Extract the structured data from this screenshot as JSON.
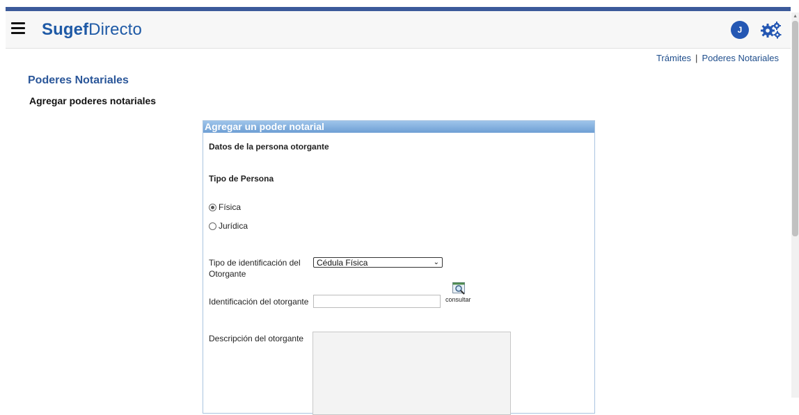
{
  "header": {
    "brand_bold": "Sugef",
    "brand_rest": "Directo",
    "avatar_initial": "J",
    "icons": [
      "hamburger-menu-icon",
      "settings-gears-icon"
    ],
    "accent_color": "#3c5a9a",
    "brand_color": "#1f5aa6"
  },
  "breadcrumb": {
    "items": [
      "Trámites",
      "Poderes Notariales"
    ],
    "separator": "|"
  },
  "page": {
    "title": "Poderes Notariales",
    "subtitle": "Agregar poderes notariales"
  },
  "form": {
    "panel_title": "Agregar un poder notarial",
    "section_grantor": "Datos de la persona otorgante",
    "section_person_type": "Tipo de Persona",
    "person_type_options": [
      {
        "label": "Física",
        "checked": true
      },
      {
        "label": "Jurídica",
        "checked": false
      }
    ],
    "id_type_label_line1": "Tipo de identificación del",
    "id_type_label_line2": "Otorgante",
    "id_type_selected": "Cédula Física",
    "id_label": "Identificación del otorgante",
    "id_value": "",
    "consult_label": "consultar",
    "description_label": "Descripción del otorgante",
    "description_value": ""
  }
}
